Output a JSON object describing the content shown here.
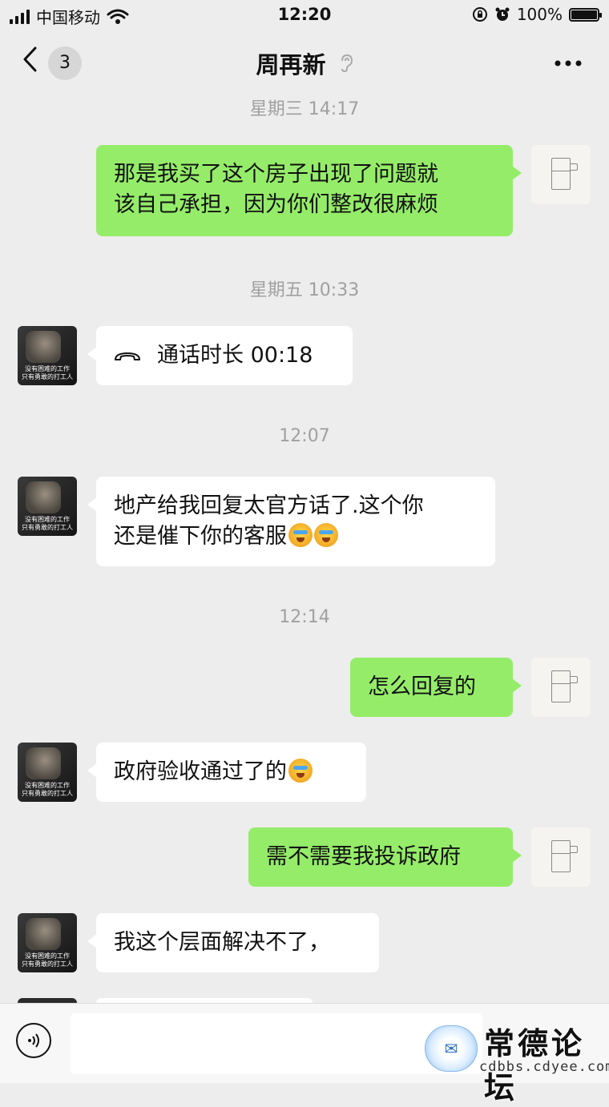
{
  "status_bar": {
    "carrier": "中国移动",
    "time": "12:20",
    "battery_percent": "100%",
    "icons": [
      "signal-icon",
      "wifi-icon",
      "rotation-lock-icon",
      "alarm-icon",
      "battery-icon"
    ]
  },
  "nav": {
    "back_icon": "chevron-left-icon",
    "unread_count": "3",
    "title": "周再新",
    "ear_icon": "ear-icon",
    "more_icon": "more-icon"
  },
  "avatars": {
    "friend_caption_line1": "没有困难的工作",
    "friend_caption_line2": "只有勇敢的打工人"
  },
  "messages": [
    {
      "type": "timestamp",
      "text": "星期三 14:17"
    },
    {
      "type": "sent",
      "text_line1": "那是我买了这个房子出现了问题就",
      "text_line2": "该自己承担，因为你们整改很麻烦"
    },
    {
      "type": "timestamp",
      "text": "星期五 10:33"
    },
    {
      "type": "received-call",
      "icon": "phone-hangup-icon",
      "text": "通话时长 00:18"
    },
    {
      "type": "timestamp",
      "text": "12:07"
    },
    {
      "type": "received",
      "text_line1": "地产给我回复太官方话了.这个你",
      "text_line2": "还是催下你的客服",
      "emoji": "face-with-tears-of-joy"
    },
    {
      "type": "timestamp",
      "text": "12:14"
    },
    {
      "type": "sent",
      "text": "怎么回复的"
    },
    {
      "type": "received",
      "text": "政府验收通过了的",
      "emoji": "face-with-tears-of-joy"
    },
    {
      "type": "sent",
      "text": "需不需要我投诉政府"
    },
    {
      "type": "received",
      "text": "我这个层面解决不了，"
    }
  ],
  "input_bar": {
    "voice_icon": "voice-icon",
    "placeholder": ""
  },
  "watermark": {
    "title": "常德论坛",
    "url": "cdbbs.cdyee.com",
    "logo_text": "常德论坛"
  },
  "colors": {
    "background": "#ededed",
    "sent_bubble": "#95ec69",
    "received_bubble": "#ffffff",
    "timestamp": "#a0a0a0"
  }
}
